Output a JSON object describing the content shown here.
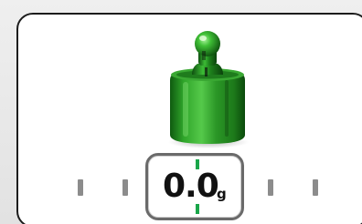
{
  "scale": {
    "reading_value": "0.0",
    "reading_unit": "g",
    "accent_color": "#1aa64a",
    "weight_icon": "weight-icon",
    "weight_color": "#2e9b2a"
  }
}
